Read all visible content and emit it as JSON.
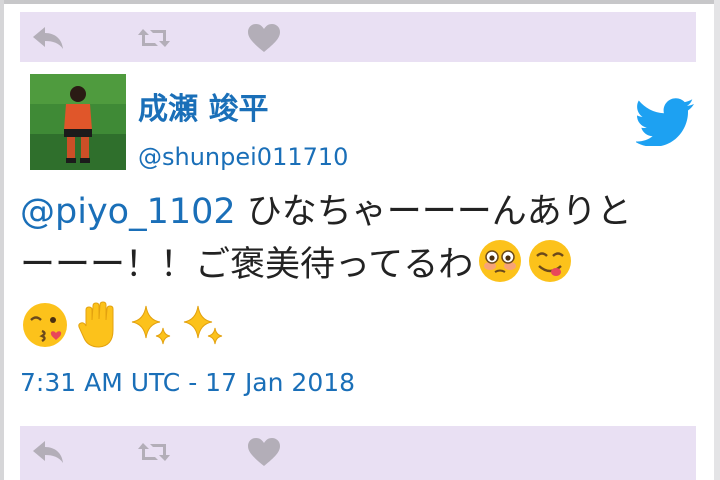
{
  "top_actions": {
    "reply": "reply-icon",
    "retweet": "retweet-icon",
    "like": "heart-icon"
  },
  "author": {
    "display_name": "成瀬 竣平",
    "handle": "@shunpei011710"
  },
  "tweet": {
    "mention": "@piyo_1102",
    "text_line1": "ひなちゃーーーんありと",
    "text_line2": "ーーー！！ご褒美待ってるわ",
    "emojis_inline": [
      "flushed-face-emoji",
      "yum-face-emoji"
    ],
    "emojis_row": [
      "kissing-wink-emoji",
      "raised-hand-emoji",
      "sparkles-emoji",
      "sparkles-emoji"
    ]
  },
  "timestamp": "7:31 AM UTC - 17 Jan 2018",
  "colors": {
    "action_bar_bg": "#e9e0f3",
    "action_icon": "#b3aeb8",
    "link_blue": "#1a6fb8",
    "twitter_blue": "#1da1f2",
    "body_text": "#222222"
  }
}
